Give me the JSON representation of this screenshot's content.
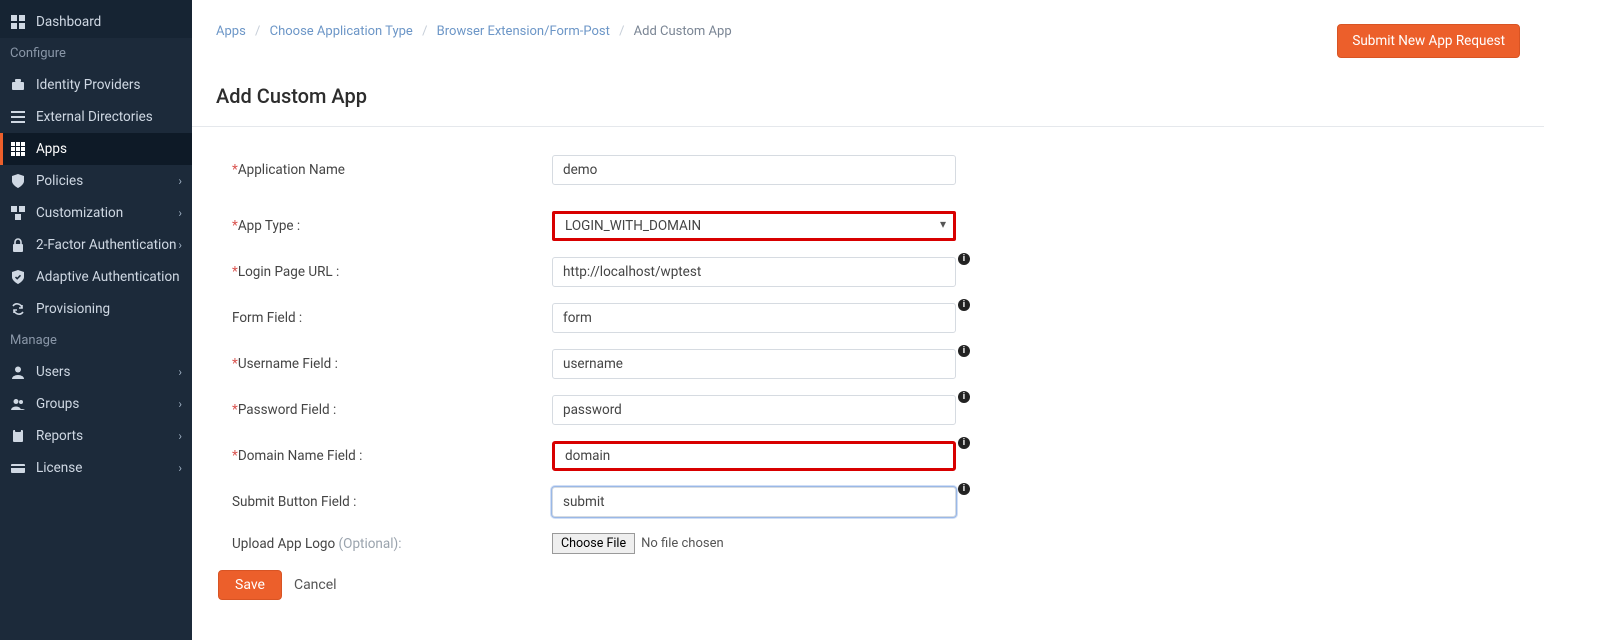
{
  "sidebar": {
    "top": {
      "label": "Dashboard"
    },
    "sections": [
      {
        "header": "Configure",
        "items": [
          {
            "id": "identity-providers",
            "label": "Identity Providers",
            "chevron": false
          },
          {
            "id": "external-directories",
            "label": "External Directories",
            "chevron": false
          },
          {
            "id": "apps",
            "label": "Apps",
            "chevron": false,
            "active": true
          },
          {
            "id": "policies",
            "label": "Policies",
            "chevron": true
          },
          {
            "id": "customization",
            "label": "Customization",
            "chevron": true
          },
          {
            "id": "two-factor-auth",
            "label": "2-Factor Authentication",
            "chevron": true
          },
          {
            "id": "adaptive-auth",
            "label": "Adaptive Authentication",
            "chevron": false
          },
          {
            "id": "provisioning",
            "label": "Provisioning",
            "chevron": false
          }
        ]
      },
      {
        "header": "Manage",
        "items": [
          {
            "id": "users",
            "label": "Users",
            "chevron": true
          },
          {
            "id": "groups",
            "label": "Groups",
            "chevron": true
          },
          {
            "id": "reports",
            "label": "Reports",
            "chevron": true
          },
          {
            "id": "license",
            "label": "License",
            "chevron": true
          }
        ]
      }
    ]
  },
  "breadcrumb": {
    "apps": "Apps",
    "choose_type": "Choose Application Type",
    "browser_ext": "Browser Extension/Form-Post",
    "current": "Add Custom App"
  },
  "buttons": {
    "submit_new": "Submit New App Request",
    "save": "Save",
    "cancel": "Cancel",
    "choose_file": "Choose File"
  },
  "page": {
    "title": "Add Custom App"
  },
  "form": {
    "app_name": {
      "label": "Application Name",
      "value": "demo",
      "required": true
    },
    "app_type": {
      "label": "App Type :",
      "value": "LOGIN_WITH_DOMAIN",
      "required": true
    },
    "login_url": {
      "label": "Login Page URL :",
      "value": "http://localhost/wptest",
      "required": true
    },
    "form_field": {
      "label": "Form Field :",
      "value": "form",
      "required": false
    },
    "username_field": {
      "label": "Username Field :",
      "value": "username",
      "required": true
    },
    "password_field": {
      "label": "Password Field :",
      "value": "password",
      "required": true
    },
    "domain_field": {
      "label": "Domain Name Field :",
      "value": "domain",
      "required": true
    },
    "submit_field": {
      "label": "Submit Button Field :",
      "value": "submit",
      "required": false
    },
    "upload_logo": {
      "label": "Upload App Logo ",
      "optional_suffix": "(Optional):",
      "no_file": "No file chosen"
    }
  }
}
